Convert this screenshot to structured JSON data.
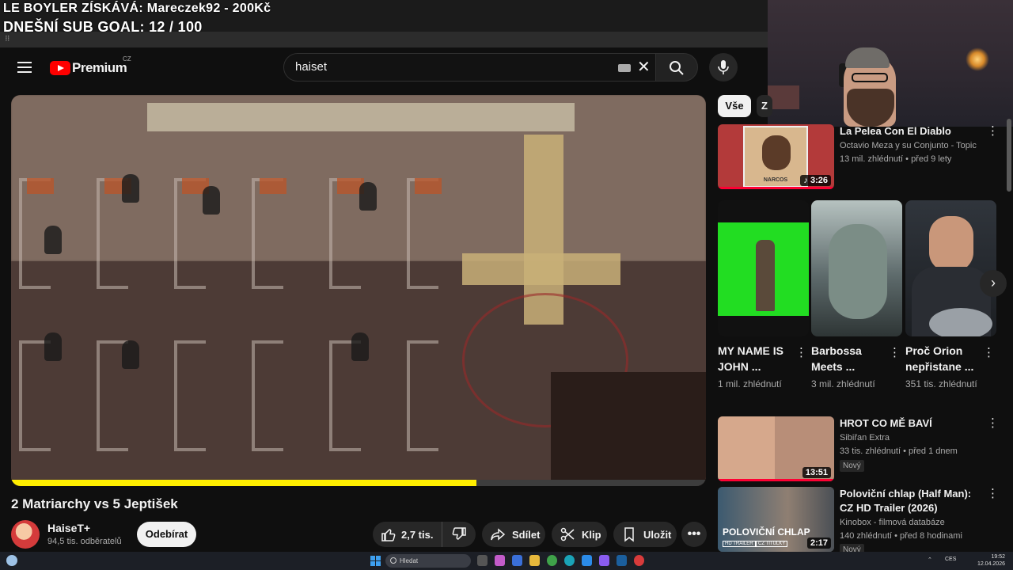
{
  "overlay": {
    "line1": "LE BOYLER ZÍSKÁVÁ: Mareczek92 - 200Kč",
    "line2": "DNEŠNÍ SUB GOAL: 12 / 100"
  },
  "header": {
    "logo_text": "Premium",
    "logo_country": "CZ",
    "search_value": "haiset",
    "icons": [
      "menu-icon",
      "keyboard-icon",
      "clear-icon",
      "search-icon",
      "mic-icon"
    ]
  },
  "video": {
    "title": "2 Matriarchy vs 5 Jeptišek",
    "progress": 0.67,
    "channel": "HaiseT+",
    "subscribers": "94,5 tis. odběratelů",
    "subscribe_label": "Odebírat",
    "likes": "2,7 tis.",
    "share_label": "Sdílet",
    "clip_label": "Klip",
    "save_label": "Uložit",
    "more_label": "•••"
  },
  "chips": {
    "active": "Vše",
    "next": "Z"
  },
  "recs": [
    {
      "title": "La Pelea Con El Diablo",
      "channel": "Octavio Meza y su Conjunto - Topic",
      "stats": "13 mil. zhlédnutí • před 9 lety",
      "duration": "♪ 3:26",
      "watched": 1.0,
      "thumb_text": "NARCOS"
    },
    {
      "title": "HROT CO MĚ BAVÍ",
      "channel": "Sibiřan Extra",
      "stats": "33 tis. zhlédnutí • před 1 dnem",
      "badge": "Nový",
      "duration": "13:51",
      "watched": 1.0
    },
    {
      "title": "Poloviční chlap (Half Man): CZ HD Trailer (2026)",
      "channel": "Kinobox - filmová databáze",
      "stats": "140 zhlédnutí • před 8 hodinami",
      "badge": "Nový",
      "duration": "2:17",
      "thumb_text": "POLOVIČNÍ CHLAP",
      "thumb_tag1": "HD TRAILER",
      "thumb_tag2": "CZ TITULKY"
    }
  ],
  "shorts": [
    {
      "title": "MY NAME IS JOHN ...",
      "views": "1 mil. zhlédnutí"
    },
    {
      "title": "Barbossa Meets ...",
      "views": "3 mil. zhlédnutí"
    },
    {
      "title": "Proč Orion nepřistane ...",
      "views": "351 tis. zhlédnutí"
    }
  ],
  "taskbar": {
    "search_placeholder": "Hledat",
    "lang": "CES",
    "time": "19:52",
    "date": "12.04.2026"
  },
  "colors": {
    "accent_red": "#ff0000",
    "progress_yellow": "#ffee00",
    "bg": "#0f0f0f"
  }
}
